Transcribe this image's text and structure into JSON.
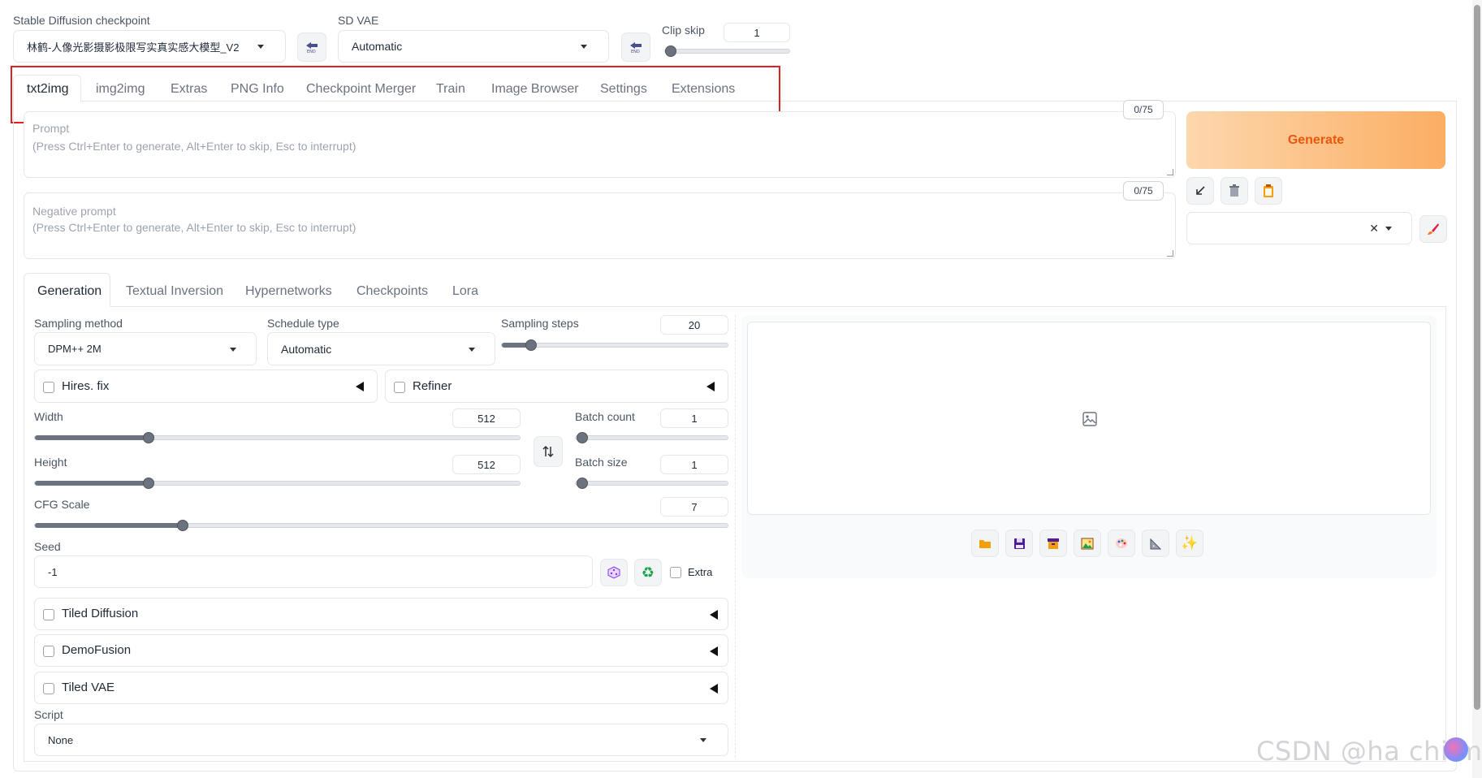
{
  "header": {
    "checkpoint_label": "Stable Diffusion checkpoint",
    "checkpoint_value": "林鹤-人像光影摄影极限写实真实感大模型_V2",
    "vae_label": "SD VAE",
    "vae_value": "Automatic",
    "clip_skip_label": "Clip skip",
    "clip_skip_value": "1",
    "clip_skip_fraction": 0.0
  },
  "main_tabs": [
    {
      "label": "txt2img",
      "active": true
    },
    {
      "label": "img2img"
    },
    {
      "label": "Extras"
    },
    {
      "label": "PNG Info"
    },
    {
      "label": "Checkpoint Merger"
    },
    {
      "label": "Train"
    },
    {
      "label": "Image Browser"
    },
    {
      "label": "Settings"
    },
    {
      "label": "Extensions"
    }
  ],
  "prompt": {
    "label": "Prompt",
    "placeholder": "(Press Ctrl+Enter to generate, Alt+Enter to skip, Esc to interrupt)",
    "counter": "0/75"
  },
  "negative_prompt": {
    "label": "Negative prompt",
    "placeholder": "(Press Ctrl+Enter to generate, Alt+Enter to skip, Esc to interrupt)",
    "counter": "0/75"
  },
  "generate_label": "Generate",
  "sub_tabs": [
    {
      "label": "Generation",
      "active": true
    },
    {
      "label": "Textual Inversion"
    },
    {
      "label": "Hypernetworks"
    },
    {
      "label": "Checkpoints"
    },
    {
      "label": "Lora"
    }
  ],
  "sampling": {
    "method_label": "Sampling method",
    "method_value": "DPM++ 2M",
    "schedule_label": "Schedule type",
    "schedule_value": "Automatic",
    "steps_label": "Sampling steps",
    "steps_value": "20"
  },
  "hires_label": "Hires. fix",
  "refiner_label": "Refiner",
  "width": {
    "label": "Width",
    "value": "512"
  },
  "height": {
    "label": "Height",
    "value": "512"
  },
  "batch_count": {
    "label": "Batch count",
    "value": "1"
  },
  "batch_size": {
    "label": "Batch size",
    "value": "1"
  },
  "cfg": {
    "label": "CFG Scale",
    "value": "7"
  },
  "seed": {
    "label": "Seed",
    "value": "-1",
    "extra_label": "Extra"
  },
  "accordions": [
    "Tiled Diffusion",
    "DemoFusion",
    "Tiled VAE"
  ],
  "script": {
    "label": "Script",
    "value": "None"
  },
  "watermark": "CSDN @ha chi mi",
  "colors": {
    "generate_from": "#fdd7ae",
    "generate_to": "#fbae63",
    "generate_text": "#ea580c",
    "highlight_border": "#e02020"
  }
}
